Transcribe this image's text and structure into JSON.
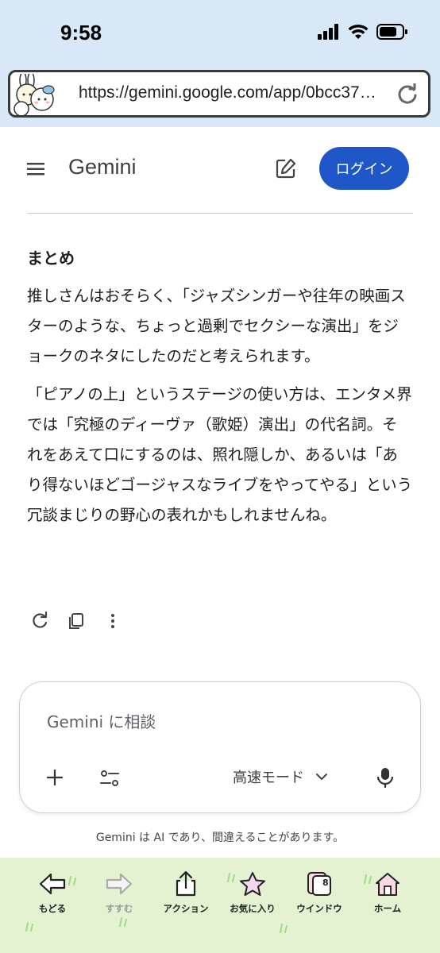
{
  "status_bar": {
    "time": "9:58"
  },
  "browser": {
    "url": "https://gemini.google.com/app/0bcc37…"
  },
  "header": {
    "title": "Gemini",
    "login_label": "ログイン"
  },
  "response": {
    "heading": "まとめ",
    "paragraphs": [
      "推しさんはおそらく、「ジャズシンガーや往年の映画スターのような、ちょっと過剰でセクシーな演出」をジョークのネタにしたのだと考えられます。",
      "「ピアノの上」というステージの使い方は、エンタメ界では「究極のディーヴァ（歌姫）演出」の代名詞。それをあえて口にするのは、照れ隠しか、あるいは「あり得ないほどゴージャスなライブをやってやる」という冗談まじりの野心の表れかもしれませんね。"
    ]
  },
  "composer": {
    "placeholder": "Gemini に相談",
    "mode_label": "高速モード"
  },
  "disclaimer": "Gemini は AI であり、間違えることがあります。",
  "toolbar": {
    "back": "もどる",
    "forward": "すすむ",
    "action": "アクション",
    "favorites": "お気に入り",
    "windows": "ウインドウ",
    "window_count": "8",
    "home": "ホーム"
  },
  "colors": {
    "accent": "#1f57c8",
    "top_bg": "#d8e8f6",
    "toolbar_bg": "#e4f2d2"
  }
}
